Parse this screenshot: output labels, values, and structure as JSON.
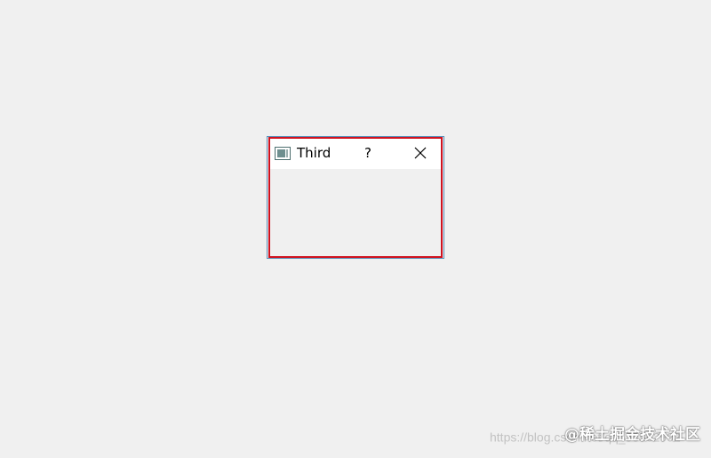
{
  "dialog": {
    "title": "Third",
    "help_label": "?",
    "icon": "window-icon",
    "close_icon": "close-icon"
  },
  "watermark": {
    "url": "https://blog.csdn.net/qq_33562992",
    "brand": "@稀土掘金技术社区"
  },
  "colors": {
    "background": "#f0f0f0",
    "titlebar": "#ffffff",
    "highlight_border": "#d0121f",
    "window_border": "#5b8fb9"
  }
}
